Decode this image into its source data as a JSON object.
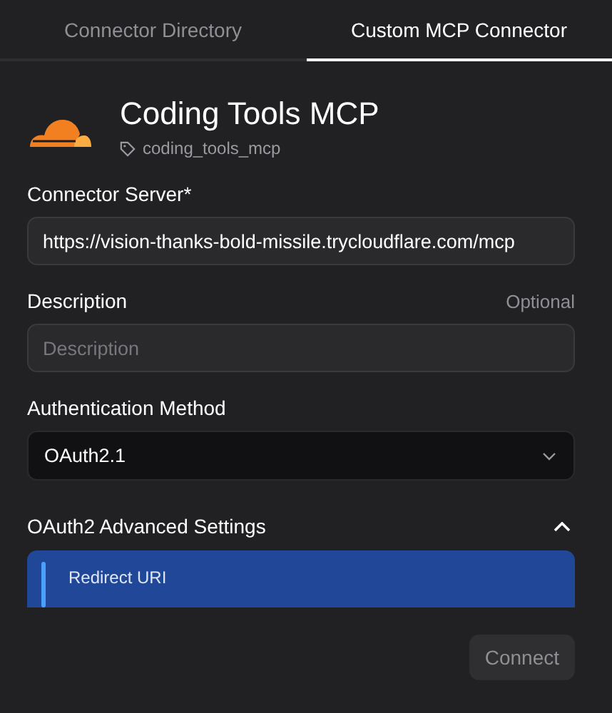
{
  "tabs": [
    {
      "label": "Connector Directory",
      "selected": false
    },
    {
      "label": "Custom MCP Connector",
      "selected": true
    }
  ],
  "connector": {
    "name": "Coding Tools MCP",
    "tag": "coding_tools_mcp"
  },
  "fields": [
    {
      "label": "Connector Server*",
      "value": "https://vision-thanks-bold-missile.trycloudflare.com/mcp"
    },
    {
      "label": "Description",
      "hint": "Optional",
      "placeholder": "Description"
    }
  ],
  "auth": {
    "label": "Authentication Method",
    "value": "OAuth2.1"
  },
  "advanced": {
    "title": "OAuth2 Advanced Settings",
    "expanded": true,
    "notice": "Redirect URI"
  },
  "connect_button": {
    "label": "Connect",
    "disabled": true
  }
}
